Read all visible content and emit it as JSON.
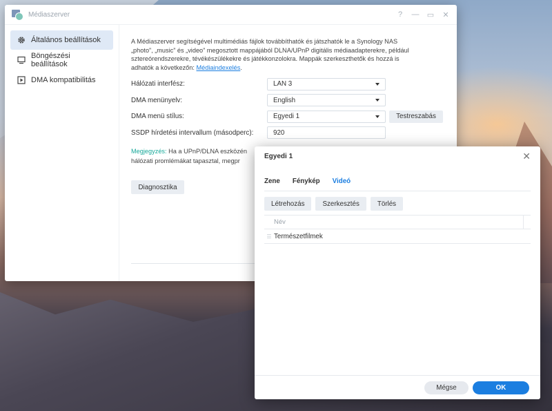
{
  "window": {
    "title": "Médiaszerver",
    "controls": [
      "?",
      "—",
      "▭",
      "✕"
    ]
  },
  "sidebar": {
    "items": [
      {
        "label": "Általános beállítások",
        "icon": "gear-icon",
        "active": true
      },
      {
        "label": "Böngészési beállítások",
        "icon": "monitor-icon",
        "active": false
      },
      {
        "label": "DMA kompatibilitás",
        "icon": "play-icon",
        "active": false
      }
    ]
  },
  "main": {
    "description": {
      "line1": "A Médiaszerver segítségével multimédiás fájlok továbbíthatók és játszhatók le a Synology NAS",
      "line2": "„photo”, „music” és „video” megosztott mappájából DLNA/UPnP digitális médiaadapterekre, például",
      "line3": "sztereórendszerekre, tévékészülékekre és játékkonzolokra. Mappák szerkeszthetők és hozzá is",
      "line4_prefix": "adhatók a következőn: ",
      "link": "Médiaindexelés",
      "line4_suffix": "."
    },
    "form": {
      "interface_label": "Hálózati interfész:",
      "interface_value": "LAN 3",
      "menu_lang_label": "DMA menünyelv:",
      "menu_lang_value": "English",
      "menu_style_label": "DMA menü stílus:",
      "menu_style_value": "Egyedi 1",
      "customize_button": "Testreszabás",
      "ssdp_label": "SSDP hírdetési intervallum (másodperc):",
      "ssdp_value": "920"
    },
    "note": {
      "prefix": "Megjegyzés:",
      "line1": " Ha a UPnP/DLNA eszközén",
      "line2": "hálózati promlémákat tapasztal, megpr"
    },
    "diagnostics_button": "Diagnosztika"
  },
  "dialog": {
    "title": "Egyedi 1",
    "close": "✕",
    "tabs": [
      {
        "label": "Zene",
        "active": false
      },
      {
        "label": "Fénykép",
        "active": false
      },
      {
        "label": "Videó",
        "active": true
      }
    ],
    "toolbar": {
      "create": "Létrehozás",
      "edit": "Szerkesztés",
      "delete": "Törlés"
    },
    "grid": {
      "header": "Név",
      "rows": [
        "Természetfilmek"
      ]
    },
    "footer": {
      "cancel": "Mégse",
      "ok": "OK"
    }
  },
  "colors": {
    "accent": "#1b7ee0",
    "note": "#18a99a",
    "active_bg": "#dfe9f6"
  }
}
